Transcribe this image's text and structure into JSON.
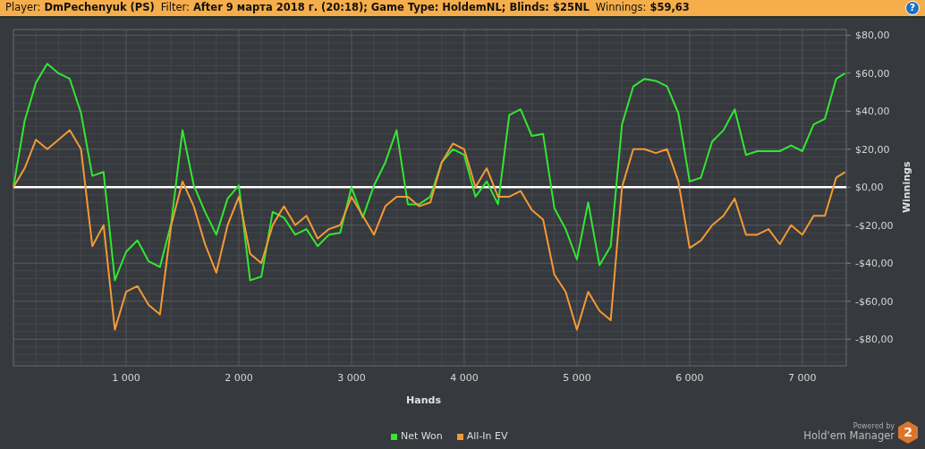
{
  "header": {
    "fields": [
      {
        "label": "Player:",
        "value": "DmPechenyuk (PS)"
      },
      {
        "label": "Filter:",
        "value": "After 9 марта 2018 г. (20:18); Game Type: HoldemNL; Blinds: $25NL"
      },
      {
        "label": "Winnings:",
        "value": "$59,63"
      }
    ],
    "help_button": {
      "label": "?"
    }
  },
  "chart": {
    "chart_data": {
      "type": "line",
      "xlabel": "Hands",
      "ylabel": "Winnings",
      "x": [
        0,
        100,
        200,
        300,
        400,
        500,
        600,
        700,
        800,
        900,
        1000,
        1100,
        1200,
        1300,
        1400,
        1500,
        1600,
        1700,
        1800,
        1900,
        2000,
        2100,
        2200,
        2300,
        2400,
        2500,
        2600,
        2700,
        2800,
        2900,
        3000,
        3100,
        3200,
        3300,
        3400,
        3500,
        3600,
        3700,
        3800,
        3900,
        4000,
        4100,
        4200,
        4300,
        4400,
        4500,
        4600,
        4700,
        4800,
        4900,
        5000,
        5100,
        5200,
        5300,
        5400,
        5500,
        5600,
        5700,
        5800,
        5900,
        6000,
        6100,
        6200,
        6300,
        6400,
        6500,
        6600,
        6700,
        6800,
        6900,
        7000,
        7100,
        7200,
        7300,
        7380
      ],
      "series": [
        {
          "name": "Net Won",
          "color": "#33e633",
          "values": [
            0,
            35,
            55,
            65,
            60,
            57,
            39,
            6,
            8,
            -49,
            -34,
            -28,
            -39,
            -42,
            -19,
            30,
            1,
            -13,
            -25,
            -6,
            1,
            -49,
            -47,
            -13,
            -16,
            -25,
            -22,
            -31,
            -25,
            -24,
            0,
            -16,
            1,
            13,
            30,
            -9,
            -9,
            -5,
            13,
            20,
            17,
            -5,
            3,
            -9,
            38,
            41,
            27,
            28,
            -11,
            -22,
            -38,
            -8,
            -41,
            -31,
            33,
            53,
            57,
            56,
            53,
            39,
            3,
            5,
            24,
            30,
            41,
            17,
            19,
            19,
            19,
            22,
            19,
            33,
            36,
            57,
            60
          ]
        },
        {
          "name": "All-In EV",
          "color": "#f39a35",
          "values": [
            0,
            10,
            25,
            20,
            25,
            30,
            20,
            -31,
            -20,
            -75,
            -55,
            -52,
            -62,
            -67,
            -20,
            3,
            -10,
            -30,
            -45,
            -20,
            -5,
            -35,
            -40,
            -20,
            -10,
            -20,
            -15,
            -27,
            -22,
            -20,
            -5,
            -15,
            -25,
            -10,
            -5,
            -5,
            -10,
            -8,
            13,
            23,
            20,
            0,
            10,
            -5,
            -5,
            -2,
            -12,
            -17,
            -46,
            -55,
            -75,
            -55,
            -65,
            -70,
            0,
            20,
            20,
            18,
            20,
            3,
            -32,
            -28,
            -20,
            -15,
            -6,
            -25,
            -25,
            -22,
            -30,
            -20,
            -25,
            -15,
            -15,
            5,
            8
          ]
        }
      ],
      "grid": true,
      "xlim": [
        0,
        7390
      ],
      "ylim": [
        -94,
        83
      ],
      "xticks": [
        {
          "value": 1000,
          "label": "1 000"
        },
        {
          "value": 2000,
          "label": "2 000"
        },
        {
          "value": 3000,
          "label": "3 000"
        },
        {
          "value": 4000,
          "label": "4 000"
        },
        {
          "value": 5000,
          "label": "5 000"
        },
        {
          "value": 6000,
          "label": "6 000"
        },
        {
          "value": 7000,
          "label": "7 000"
        }
      ],
      "yticks": [
        {
          "value": 80,
          "label": "$80,00"
        },
        {
          "value": 60,
          "label": "$60,00"
        },
        {
          "value": 40,
          "label": "$40,00"
        },
        {
          "value": 20,
          "label": "$20,00"
        },
        {
          "value": 0,
          "label": "$0,00"
        },
        {
          "value": -20,
          "label": "-$20,00"
        },
        {
          "value": -40,
          "label": "-$40,00"
        },
        {
          "value": -60,
          "label": "-$60,00"
        },
        {
          "value": -80,
          "label": "-$80,00"
        }
      ]
    }
  },
  "logo": {
    "powered_by": "Powered by",
    "name": "Hold'em Manager",
    "badge": "2"
  }
}
